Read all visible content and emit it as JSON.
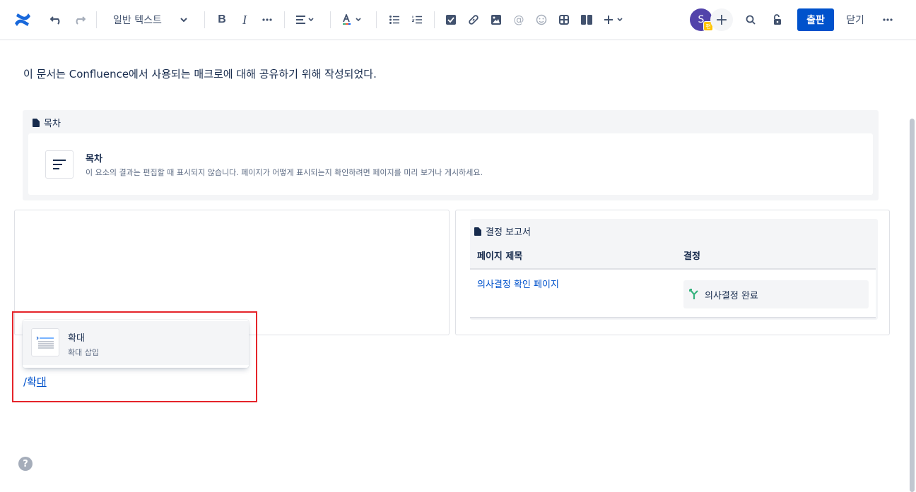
{
  "toolbar": {
    "text_style": "일반 텍스트",
    "publish_label": "출판",
    "close_label": "닫기",
    "avatar_initial": "S",
    "avatar_badge": "편"
  },
  "content": {
    "intro": "이 문서는 Confluence에서 사용되는 매크로에 대해 공유하기 위해 작성되었다.",
    "toc": {
      "header": "목차",
      "title": "목차",
      "description": "이 요소의 결과는 편집할 때 표시되지 않습니다. 페이지가 어떻게 표시되는지 확인하려면 페이지를 미리 보거나 게시하세요."
    },
    "decision_report": {
      "header": "결정 보고서",
      "columns": [
        "페이지 제목",
        "결정"
      ],
      "rows": [
        {
          "page_title": "의사결정 확인 페이지",
          "decision": "의사결정 완료"
        }
      ]
    }
  },
  "slash_menu": {
    "item_title": "확대",
    "item_subtitle": "확대 삽입",
    "typed_prefix": "/확",
    "typed_suffix": "대"
  },
  "colors": {
    "accent": "#0052cc",
    "avatar": "#5243aa",
    "highlight_frame": "#e5242a"
  }
}
